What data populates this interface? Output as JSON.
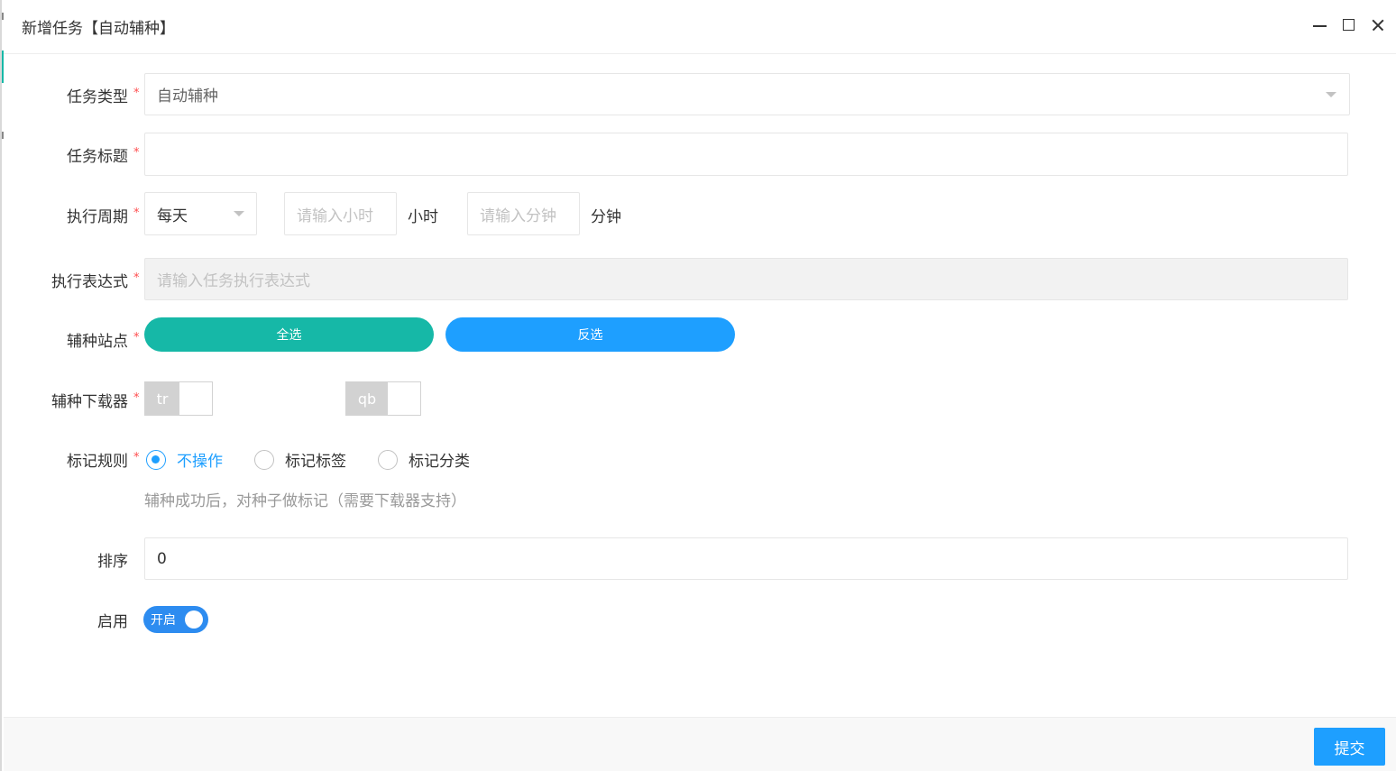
{
  "window": {
    "title": "新增任务【自动辅种】"
  },
  "form": {
    "task_type": {
      "label": "任务类型",
      "value": "自动辅种"
    },
    "task_title": {
      "label": "任务标题",
      "value": ""
    },
    "cycle": {
      "label": "执行周期",
      "selected": "每天",
      "hour_placeholder": "请输入小时",
      "hour_unit": "小时",
      "minute_placeholder": "请输入分钟",
      "minute_unit": "分钟"
    },
    "expression": {
      "label": "执行表达式",
      "placeholder": "请输入任务执行表达式"
    },
    "sites": {
      "label": "辅种站点",
      "select_all": "全选",
      "invert": "反选"
    },
    "downloaders": {
      "label": "辅种下载器",
      "items": [
        "tr",
        "qb"
      ]
    },
    "mark_rule": {
      "label": "标记规则",
      "options": [
        "不操作",
        "标记标签",
        "标记分类"
      ],
      "selected": "不操作",
      "hint": "辅种成功后，对种子做标记（需要下载器支持）"
    },
    "sort": {
      "label": "排序",
      "value": "0"
    },
    "enable": {
      "label": "启用",
      "switch_text": "开启"
    }
  },
  "footer": {
    "submit": "提交"
  },
  "colors": {
    "primary": "#1e9fff",
    "teal": "#16b8a7",
    "required": "#ff4d4f",
    "switch_on": "#2d8cf0"
  }
}
